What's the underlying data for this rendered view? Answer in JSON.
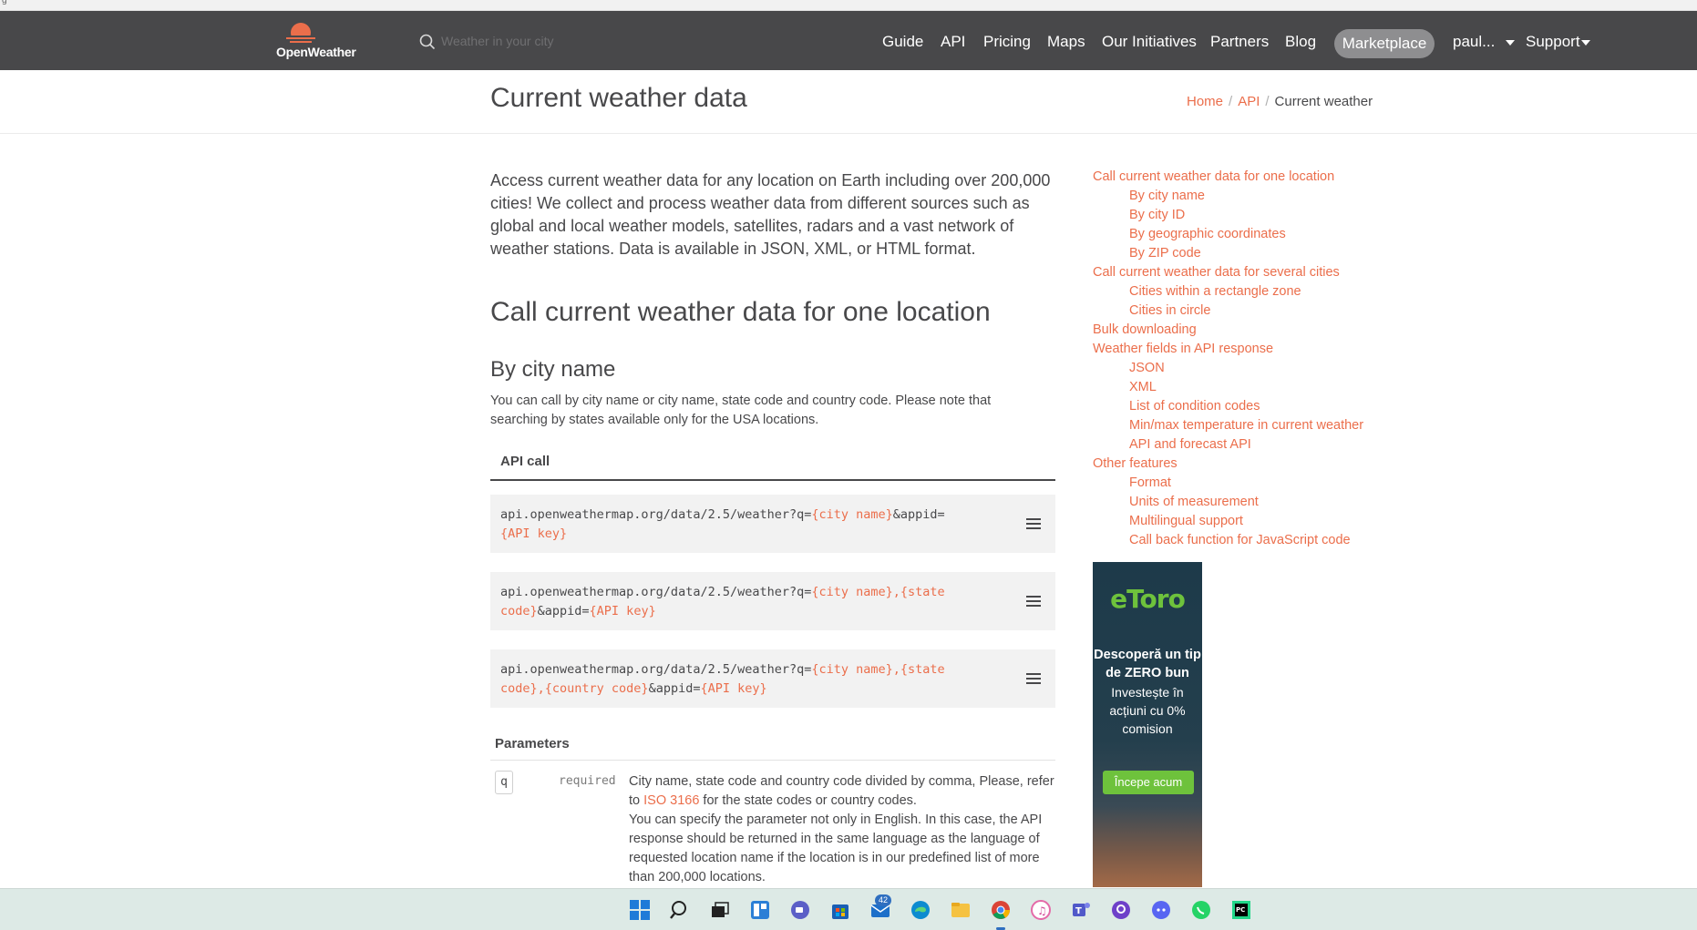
{
  "browser": {
    "strip_text": "g"
  },
  "navbar": {
    "logo_text": "OpenWeather",
    "search_placeholder": "Weather in your city",
    "items": [
      "Guide",
      "API",
      "Pricing",
      "Maps",
      "Our Initiatives",
      "Partners",
      "Blog"
    ],
    "marketplace": "Marketplace",
    "user": "paul...",
    "support": "Support",
    "colors": {
      "bar": "#48484a",
      "accent": "#eb6e4b",
      "marketplace_pill": "#8e8e90"
    }
  },
  "header": {
    "title": "Current weather data",
    "breadcrumb": [
      "Home",
      "API",
      "Current weather"
    ]
  },
  "main": {
    "intro": "Access current weather data for any location on Earth including over 200,000 cities! We collect and process weather data from different sources such as global and local weather models, satellites, radars and a vast network of weather stations. Data is available in JSON, XML, or HTML format.",
    "section_title": "Call current weather data for one location",
    "sub_title": "By city name",
    "sub_desc": "You can call by city name or city name, state code and country code. Please note that searching by states available only for the USA locations.",
    "tab_label": "API call",
    "code": [
      {
        "prefix": "api.openweathermap.org/data/2.5/weather?q=",
        "p1": "{city name}",
        "mid": "&appid=",
        "p2": "{API key}"
      },
      {
        "prefix": "api.openweathermap.org/data/2.5/weather?q=",
        "p1": "{city name},{state code}",
        "mid": "&appid=",
        "p2": "{API key}"
      },
      {
        "prefix": "api.openweathermap.org/data/2.5/weather?q=",
        "p1": "{city name},{state code},{country code}",
        "mid": "&appid=",
        "p2": "{API key}"
      }
    ],
    "params_title": "Parameters",
    "param": {
      "name": "q",
      "required": "required",
      "desc_1": "City name, state code and country code divided by comma, Please, refer to ",
      "link": "ISO 3166",
      "desc_2": " for the state codes or country codes.",
      "desc_3": "You can specify the parameter not only in English. In this case, the API response should be returned in the same language as the language of requested location name if the location is in our predefined list of more than 200,000 locations."
    }
  },
  "toc": [
    {
      "label": "Call current weather data for one location",
      "level": 0
    },
    {
      "label": "By city name",
      "level": 1
    },
    {
      "label": "By city ID",
      "level": 1
    },
    {
      "label": "By geographic coordinates",
      "level": 1
    },
    {
      "label": "By ZIP code",
      "level": 1
    },
    {
      "label": "Call current weather data for several cities",
      "level": 0
    },
    {
      "label": "Cities within a rectangle zone",
      "level": 1
    },
    {
      "label": "Cities in circle",
      "level": 1
    },
    {
      "label": "Bulk downloading",
      "level": 0
    },
    {
      "label": "Weather fields in API response",
      "level": 0
    },
    {
      "label": "JSON",
      "level": 1
    },
    {
      "label": "XML",
      "level": 1
    },
    {
      "label": "List of condition codes",
      "level": 1
    },
    {
      "label": "Min/max temperature in current weather",
      "level": 1
    },
    {
      "label": "API and forecast API",
      "level": 1
    },
    {
      "label": "Other features",
      "level": 0
    },
    {
      "label": "Format",
      "level": 1
    },
    {
      "label": "Units of measurement",
      "level": 1
    },
    {
      "label": "Multilingual support",
      "level": 1
    },
    {
      "label": "Call back function for JavaScript code",
      "level": 1
    }
  ],
  "ad": {
    "logo": "eToro",
    "headline": "Descoperă un tip de ZERO bun",
    "body": "Investește în acțiuni cu 0% comision",
    "button": "Începe acum"
  },
  "taskbar": {
    "mail_badge": "42",
    "icons": [
      "windows-start-icon",
      "search-icon",
      "task-view-icon",
      "widgets-icon",
      "chat-icon",
      "store-icon",
      "mail-icon",
      "edge-icon",
      "file-explorer-icon",
      "chrome-icon",
      "itunes-icon",
      "teams-icon",
      "github-desktop-icon",
      "discord-icon",
      "whatsapp-icon",
      "pycharm-icon"
    ]
  }
}
